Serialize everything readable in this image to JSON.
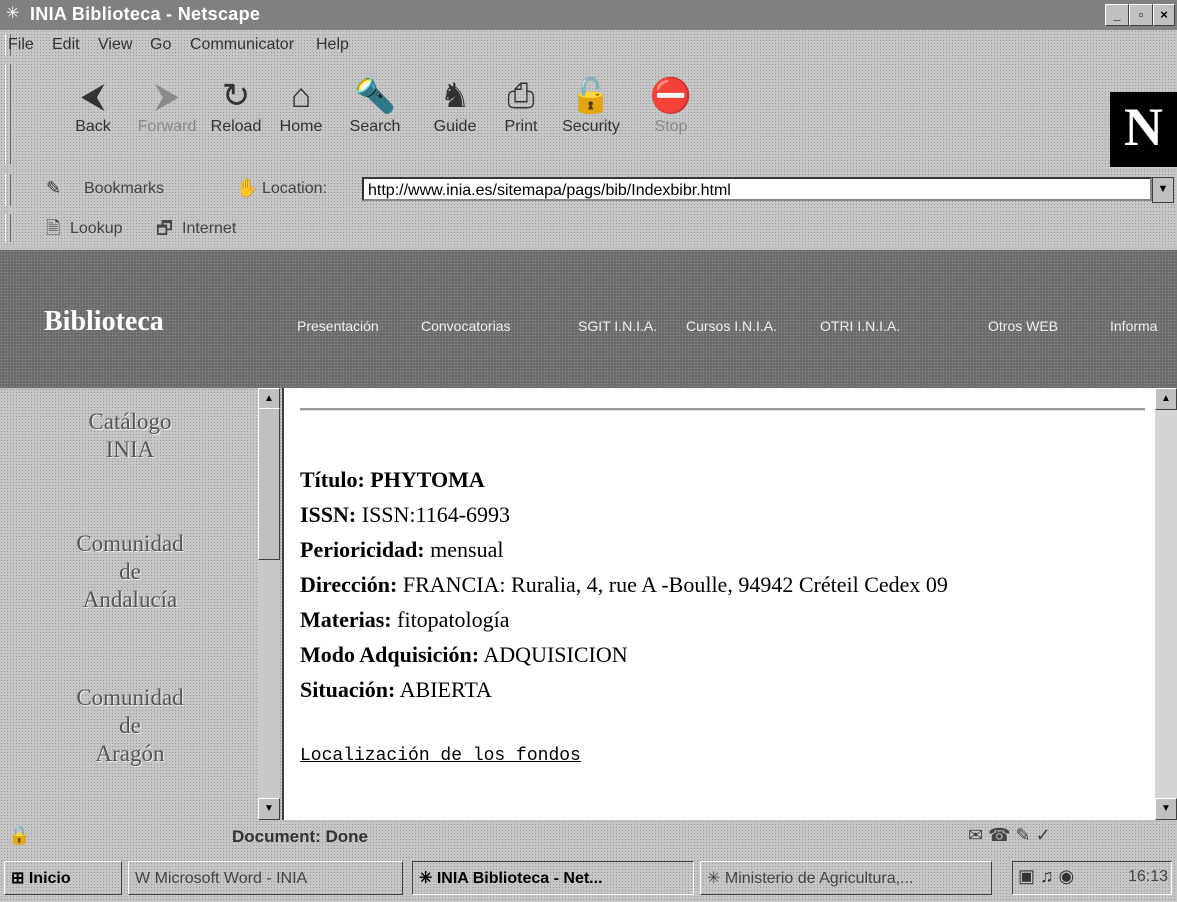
{
  "window": {
    "title": "INIA Biblioteca - Netscape"
  },
  "menu": [
    "File",
    "Edit",
    "View",
    "Go",
    "Communicator",
    "Help"
  ],
  "toolbar": [
    {
      "label": "Back",
      "icon": "back-icon",
      "enabled": true
    },
    {
      "label": "Forward",
      "icon": "forward-icon",
      "enabled": false
    },
    {
      "label": "Reload",
      "icon": "reload-icon",
      "enabled": true
    },
    {
      "label": "Home",
      "icon": "home-icon",
      "enabled": true
    },
    {
      "label": "Search",
      "icon": "search-icon",
      "enabled": true
    },
    {
      "label": "Guide",
      "icon": "guide-icon",
      "enabled": true
    },
    {
      "label": "Print",
      "icon": "print-icon",
      "enabled": true
    },
    {
      "label": "Security",
      "icon": "security-icon",
      "enabled": true
    },
    {
      "label": "Stop",
      "icon": "stop-icon",
      "enabled": false
    }
  ],
  "location": {
    "bookmarks_label": "Bookmarks",
    "location_label": "Location:",
    "url": "http://www.inia.es/sitemapa/pags/bib/Indexbibr.html"
  },
  "personal": {
    "lookup": "Lookup",
    "internet": "Internet"
  },
  "site": {
    "title": "Biblioteca",
    "nav": [
      "Presentación",
      "Convocatorias",
      "SGIT I.N.I.A.",
      "Cursos I.N.I.A.",
      "OTRI I.N.I.A.",
      "Otros WEB",
      "Informa"
    ]
  },
  "sidebar": [
    {
      "line1": "Catálogo",
      "line2": "INIA",
      "line3": ""
    },
    {
      "line1": "Comunidad",
      "line2": "de",
      "line3": "Andalucía"
    },
    {
      "line1": "Comunidad",
      "line2": "de",
      "line3": "Aragón"
    }
  ],
  "record": {
    "titulo_label": "Título:",
    "titulo": "PHYTOMA",
    "issn_label": "ISSN:",
    "issn": "ISSN:1164-6993",
    "periodicidad_label": "Perioricidad:",
    "periodicidad": "mensual",
    "direccion_label": "Dirección:",
    "direccion": "FRANCIA: Ruralia, 4, rue A -Boulle, 94942 Créteil Cedex 09",
    "materias_label": "Materias:",
    "materias": "fitopatología",
    "modo_label": "Modo Adquisición:",
    "modo": "ADQUISICION",
    "situacion_label": "Situación:",
    "situacion": "ABIERTA",
    "link": "Localización de los fondos"
  },
  "status": {
    "text": "Document: Done"
  },
  "taskbar": {
    "start": "Inicio",
    "tasks": [
      "Microsoft Word - INIA",
      "INIA Biblioteca - Net...",
      "Ministerio de Agricultura,..."
    ],
    "clock": "16:13"
  }
}
